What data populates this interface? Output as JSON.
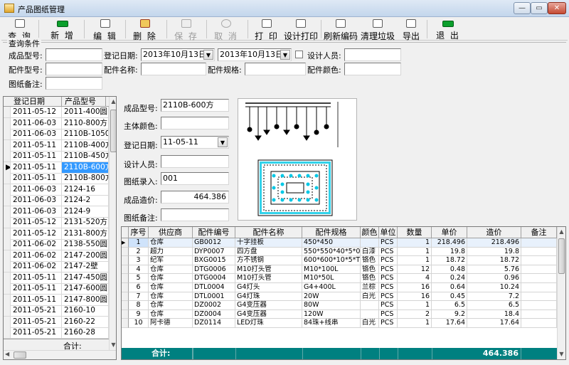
{
  "window": {
    "title": "产品图纸管理",
    "min": "—",
    "max": "▭",
    "close": "✕"
  },
  "toolbar": [
    {
      "id": "query",
      "label": "查 询",
      "icon": "magnifier-icon",
      "enabled": true
    },
    {
      "id": "add",
      "label": "新 增",
      "icon": "new-icon",
      "enabled": true
    },
    {
      "id": "edit",
      "label": "编 辑",
      "icon": "edit-icon",
      "enabled": true
    },
    {
      "id": "delete",
      "label": "删 除",
      "icon": "delete-icon",
      "enabled": true
    },
    {
      "id": "save",
      "label": "保 存",
      "icon": "floppy-icon",
      "enabled": false
    },
    {
      "id": "cancel",
      "label": "取 消",
      "icon": "undo-icon",
      "enabled": false
    },
    {
      "id": "print",
      "label": "打 印",
      "icon": "printer-icon",
      "enabled": true
    },
    {
      "id": "design_print",
      "label": "设计打印",
      "icon": "design-print-icon",
      "enabled": true
    },
    {
      "id": "refresh_code",
      "label": "刷新编码",
      "icon": "refresh-icon",
      "enabled": true
    },
    {
      "id": "clean_trash",
      "label": "清理垃圾",
      "icon": "trash-icon",
      "enabled": true
    },
    {
      "id": "export",
      "label": "导出",
      "icon": "export-icon",
      "enabled": true
    },
    {
      "id": "exit",
      "label": "退 出",
      "icon": "exit-icon",
      "enabled": true
    }
  ],
  "query": {
    "group_title": "查询条件",
    "product_model_label": "成品型号:",
    "reg_date_label": "登记日期:",
    "date_from": "2013年10月13日",
    "date_to": "2013年10月13日",
    "designer_label": "设计人员:",
    "part_model_label": "配件型号:",
    "part_name_label": "配件名称:",
    "part_spec_label": "配件规格:",
    "part_color_label": "配件颜色:",
    "remark_label": "图纸备注:"
  },
  "list": {
    "headers": [
      "登记日期",
      "产品型号"
    ],
    "rows": [
      [
        "2011-05-12",
        "2011-400圆"
      ],
      [
        "2011-06-03",
        "2110-800方"
      ],
      [
        "2011-06-03",
        "2110B-1050"
      ],
      [
        "2011-05-11",
        "2110B-400方"
      ],
      [
        "2011-05-11",
        "2110B-450方"
      ],
      [
        "2011-05-11",
        "2110B-600方"
      ],
      [
        "2011-05-11",
        "2110B-800方"
      ],
      [
        "2011-06-03",
        "2124-16"
      ],
      [
        "2011-06-03",
        "2124-2"
      ],
      [
        "2011-06-03",
        "2124-9"
      ],
      [
        "2011-05-12",
        "2131-520方"
      ],
      [
        "2011-05-12",
        "2131-800方"
      ],
      [
        "2011-06-02",
        "2138-550圆"
      ],
      [
        "2011-06-02",
        "2147-200圆"
      ],
      [
        "2011-06-02",
        "2147-2壁"
      ],
      [
        "2011-05-11",
        "2147-450圆"
      ],
      [
        "2011-05-11",
        "2147-600圆"
      ],
      [
        "2011-05-11",
        "2147-800圆"
      ],
      [
        "2011-05-21",
        "2160-10"
      ],
      [
        "2011-05-21",
        "2160-22"
      ],
      [
        "2011-05-21",
        "2160-28"
      ]
    ],
    "selected_index": 5,
    "footer": "合计:"
  },
  "detail": {
    "product_model_label": "成品型号:",
    "product_model": "2110B-600方",
    "main_color_label": "主体颜色:",
    "main_color": "",
    "reg_date_label": "登记日期:",
    "reg_date": "11-05-11",
    "designer_label": "设计人员:",
    "designer": "",
    "drawing_entry_label": "图纸录入:",
    "drawing_entry": "001",
    "cost_label": "成品造价:",
    "cost": "464.386",
    "remark_label": "图纸备注:",
    "remark": ""
  },
  "parts": {
    "headers": [
      "序号",
      "供应商",
      "配件编号",
      "配件名称",
      "配件规格",
      "颜色",
      "单位",
      "数量",
      "单价",
      "造价",
      "备注"
    ],
    "rows": [
      [
        "1",
        "仓库",
        "GB0012",
        "十字挂板",
        "450*450",
        "",
        "PCS",
        "1",
        "218.496",
        "218.496",
        ""
      ],
      [
        "2",
        "超力",
        "DYP0007",
        "四方盘",
        "550*550*40*5*0",
        "白漆",
        "PCS",
        "1",
        "19.8",
        "19.8",
        ""
      ],
      [
        "3",
        "纪军",
        "BXG0015",
        "方不锈钢",
        "600*600*10*5*T",
        "铬色",
        "PCS",
        "1",
        "18.72",
        "18.72",
        ""
      ],
      [
        "4",
        "仓库",
        "DTG0006",
        "M10打头管",
        "M10*100L",
        "铬色",
        "PCS",
        "12",
        "0.48",
        "5.76",
        ""
      ],
      [
        "5",
        "仓库",
        "DTG0004",
        "M10打头管",
        "M10*50L",
        "铬色",
        "PCS",
        "4",
        "0.24",
        "0.96",
        ""
      ],
      [
        "6",
        "仓库",
        "DTL0004",
        "G4灯头",
        "G4+400L",
        "兰棕",
        "PCS",
        "16",
        "0.64",
        "10.24",
        ""
      ],
      [
        "7",
        "仓库",
        "DTL0001",
        "G4灯珠",
        "20W",
        "白光",
        "PCS",
        "16",
        "0.45",
        "7.2",
        ""
      ],
      [
        "8",
        "仓库",
        "DZ0002",
        "G4变压器",
        "80W",
        "",
        "PCS",
        "1",
        "6.5",
        "6.5",
        ""
      ],
      [
        "9",
        "仓库",
        "DZ0004",
        "G4变压器",
        "120W",
        "",
        "PCS",
        "2",
        "9.2",
        "18.4",
        ""
      ],
      [
        "10",
        "阿卡德",
        "DZ0114",
        "LED灯珠",
        "84珠+线串",
        "白光",
        "PCS",
        "1",
        "17.64",
        "17.64",
        ""
      ]
    ],
    "selected_index": 0,
    "footer_label": "合计:",
    "footer_total": "464.386"
  }
}
